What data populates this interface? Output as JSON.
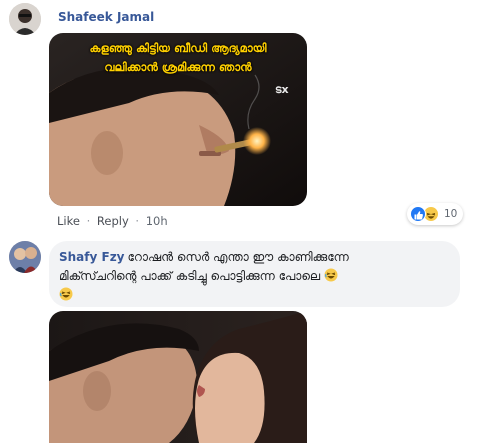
{
  "comments": [
    {
      "author": "Shafeek Jamal",
      "meme_caption_line1": "കളഞ്ഞു കിട്ടിയ ബീഡി ആദ്യമായി",
      "meme_caption_line2": "വലിക്കാൻ ശ്രമിക്കുന്ന ഞാൻ",
      "watermark": "ടx",
      "actions": {
        "like": "Like",
        "separator": "·",
        "reply": "Reply",
        "time": "10h"
      },
      "reactions": {
        "icons": [
          "like-icon",
          "haha-icon"
        ],
        "count": "10"
      }
    },
    {
      "author": "Shafy Fzy",
      "text_line1": "റോഷൻ സെർ എന്താ ഈ കാണിക്കുന്നേ",
      "text_line2": "മിക്സ്ചറിന്റെ പാക്ക് കടിച്ചു പൊട്ടിക്കുന്ന പോലെ",
      "emojis": [
        "laughing-emoji",
        "laughing-emoji"
      ]
    }
  ],
  "colors": {
    "name_link": "#385898",
    "bubble_bg": "#f2f3f5",
    "meta_text": "#606770",
    "like_blue": "#2078f4",
    "caption_yellow": "#ffd000"
  }
}
